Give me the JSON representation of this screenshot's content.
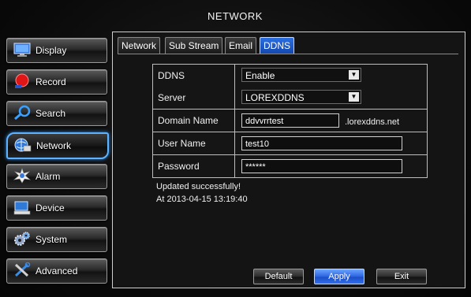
{
  "window": {
    "title": "NETWORK"
  },
  "sidebar": {
    "items": [
      {
        "label": "Display",
        "icon": "monitor-icon",
        "active": false
      },
      {
        "label": "Record",
        "icon": "record-icon",
        "active": false
      },
      {
        "label": "Search",
        "icon": "magnifier-icon",
        "active": false
      },
      {
        "label": "Network",
        "icon": "network-icon",
        "active": true
      },
      {
        "label": "Alarm",
        "icon": "alarm-icon",
        "active": false
      },
      {
        "label": "Device",
        "icon": "device-icon",
        "active": false
      },
      {
        "label": "System",
        "icon": "gears-icon",
        "active": false
      },
      {
        "label": "Advanced",
        "icon": "tools-icon",
        "active": false
      }
    ]
  },
  "tabs": [
    {
      "label": "Network",
      "active": false
    },
    {
      "label": "Sub Stream",
      "active": false
    },
    {
      "label": "Email",
      "active": false
    },
    {
      "label": "DDNS",
      "active": true
    }
  ],
  "form": {
    "ddns": {
      "label": "DDNS",
      "value": "Enable"
    },
    "server": {
      "label": "Server",
      "value": "LOREXDDNS"
    },
    "domain": {
      "label": "Domain Name",
      "value": "ddvvrrtest",
      "suffix": ".lorexddns.net"
    },
    "user": {
      "label": "User Name",
      "value": "test10"
    },
    "password": {
      "label": "Password",
      "value": "******"
    }
  },
  "status": {
    "message": "Updated successfully!",
    "timestamp": "At 2013-04-15 13:19:40"
  },
  "buttons": {
    "default": "Default",
    "apply": "Apply",
    "exit": "Exit"
  },
  "colors": {
    "accent": "#2b64e0",
    "active_outline": "#5eb3ff",
    "record_red": "#e01515"
  }
}
